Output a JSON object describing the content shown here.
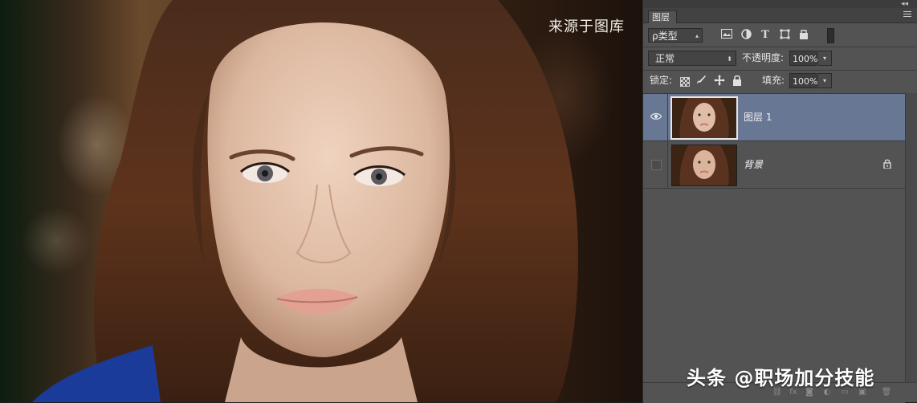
{
  "canvas": {
    "watermark_top": "来源于图库"
  },
  "panel": {
    "tab_label": "图层",
    "filter": {
      "kind_label": "ρ类型",
      "icons": [
        "image-filter-icon",
        "adjustment-filter-icon",
        "type-filter-icon",
        "shape-filter-icon",
        "smart-object-filter-icon"
      ]
    },
    "blend": {
      "mode": "正常",
      "opacity_label": "不透明度:",
      "opacity_value": "100%"
    },
    "lock": {
      "label": "锁定:",
      "fill_label": "填充:",
      "fill_value": "100%"
    },
    "layers": [
      {
        "name": "图层 1",
        "visible": true,
        "selected": true
      },
      {
        "name": "背景",
        "visible": false,
        "selected": false,
        "locked": true
      }
    ]
  },
  "watermark_bottom": "头条 @职场加分技能",
  "colors": {
    "panel_bg": "#535353",
    "selected_layer": "#687793"
  }
}
